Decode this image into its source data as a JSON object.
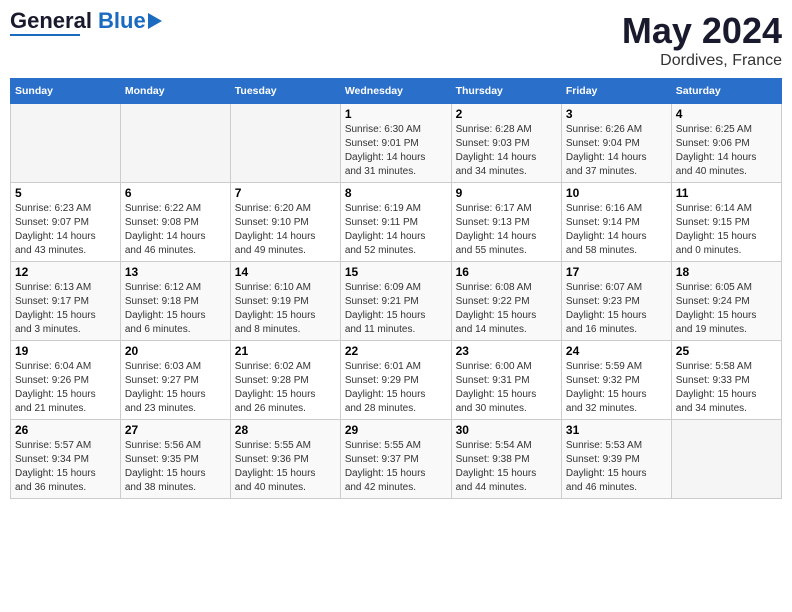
{
  "header": {
    "logo_general": "General",
    "logo_blue": "Blue",
    "month_title": "May 2024",
    "location": "Dordives, France"
  },
  "weekdays": [
    "Sunday",
    "Monday",
    "Tuesday",
    "Wednesday",
    "Thursday",
    "Friday",
    "Saturday"
  ],
  "weeks": [
    [
      {
        "day": "",
        "info": ""
      },
      {
        "day": "",
        "info": ""
      },
      {
        "day": "",
        "info": ""
      },
      {
        "day": "1",
        "info": "Sunrise: 6:30 AM\nSunset: 9:01 PM\nDaylight: 14 hours\nand 31 minutes."
      },
      {
        "day": "2",
        "info": "Sunrise: 6:28 AM\nSunset: 9:03 PM\nDaylight: 14 hours\nand 34 minutes."
      },
      {
        "day": "3",
        "info": "Sunrise: 6:26 AM\nSunset: 9:04 PM\nDaylight: 14 hours\nand 37 minutes."
      },
      {
        "day": "4",
        "info": "Sunrise: 6:25 AM\nSunset: 9:06 PM\nDaylight: 14 hours\nand 40 minutes."
      }
    ],
    [
      {
        "day": "5",
        "info": "Sunrise: 6:23 AM\nSunset: 9:07 PM\nDaylight: 14 hours\nand 43 minutes."
      },
      {
        "day": "6",
        "info": "Sunrise: 6:22 AM\nSunset: 9:08 PM\nDaylight: 14 hours\nand 46 minutes."
      },
      {
        "day": "7",
        "info": "Sunrise: 6:20 AM\nSunset: 9:10 PM\nDaylight: 14 hours\nand 49 minutes."
      },
      {
        "day": "8",
        "info": "Sunrise: 6:19 AM\nSunset: 9:11 PM\nDaylight: 14 hours\nand 52 minutes."
      },
      {
        "day": "9",
        "info": "Sunrise: 6:17 AM\nSunset: 9:13 PM\nDaylight: 14 hours\nand 55 minutes."
      },
      {
        "day": "10",
        "info": "Sunrise: 6:16 AM\nSunset: 9:14 PM\nDaylight: 14 hours\nand 58 minutes."
      },
      {
        "day": "11",
        "info": "Sunrise: 6:14 AM\nSunset: 9:15 PM\nDaylight: 15 hours\nand 0 minutes."
      }
    ],
    [
      {
        "day": "12",
        "info": "Sunrise: 6:13 AM\nSunset: 9:17 PM\nDaylight: 15 hours\nand 3 minutes."
      },
      {
        "day": "13",
        "info": "Sunrise: 6:12 AM\nSunset: 9:18 PM\nDaylight: 15 hours\nand 6 minutes."
      },
      {
        "day": "14",
        "info": "Sunrise: 6:10 AM\nSunset: 9:19 PM\nDaylight: 15 hours\nand 8 minutes."
      },
      {
        "day": "15",
        "info": "Sunrise: 6:09 AM\nSunset: 9:21 PM\nDaylight: 15 hours\nand 11 minutes."
      },
      {
        "day": "16",
        "info": "Sunrise: 6:08 AM\nSunset: 9:22 PM\nDaylight: 15 hours\nand 14 minutes."
      },
      {
        "day": "17",
        "info": "Sunrise: 6:07 AM\nSunset: 9:23 PM\nDaylight: 15 hours\nand 16 minutes."
      },
      {
        "day": "18",
        "info": "Sunrise: 6:05 AM\nSunset: 9:24 PM\nDaylight: 15 hours\nand 19 minutes."
      }
    ],
    [
      {
        "day": "19",
        "info": "Sunrise: 6:04 AM\nSunset: 9:26 PM\nDaylight: 15 hours\nand 21 minutes."
      },
      {
        "day": "20",
        "info": "Sunrise: 6:03 AM\nSunset: 9:27 PM\nDaylight: 15 hours\nand 23 minutes."
      },
      {
        "day": "21",
        "info": "Sunrise: 6:02 AM\nSunset: 9:28 PM\nDaylight: 15 hours\nand 26 minutes."
      },
      {
        "day": "22",
        "info": "Sunrise: 6:01 AM\nSunset: 9:29 PM\nDaylight: 15 hours\nand 28 minutes."
      },
      {
        "day": "23",
        "info": "Sunrise: 6:00 AM\nSunset: 9:31 PM\nDaylight: 15 hours\nand 30 minutes."
      },
      {
        "day": "24",
        "info": "Sunrise: 5:59 AM\nSunset: 9:32 PM\nDaylight: 15 hours\nand 32 minutes."
      },
      {
        "day": "25",
        "info": "Sunrise: 5:58 AM\nSunset: 9:33 PM\nDaylight: 15 hours\nand 34 minutes."
      }
    ],
    [
      {
        "day": "26",
        "info": "Sunrise: 5:57 AM\nSunset: 9:34 PM\nDaylight: 15 hours\nand 36 minutes."
      },
      {
        "day": "27",
        "info": "Sunrise: 5:56 AM\nSunset: 9:35 PM\nDaylight: 15 hours\nand 38 minutes."
      },
      {
        "day": "28",
        "info": "Sunrise: 5:55 AM\nSunset: 9:36 PM\nDaylight: 15 hours\nand 40 minutes."
      },
      {
        "day": "29",
        "info": "Sunrise: 5:55 AM\nSunset: 9:37 PM\nDaylight: 15 hours\nand 42 minutes."
      },
      {
        "day": "30",
        "info": "Sunrise: 5:54 AM\nSunset: 9:38 PM\nDaylight: 15 hours\nand 44 minutes."
      },
      {
        "day": "31",
        "info": "Sunrise: 5:53 AM\nSunset: 9:39 PM\nDaylight: 15 hours\nand 46 minutes."
      },
      {
        "day": "",
        "info": ""
      }
    ]
  ]
}
